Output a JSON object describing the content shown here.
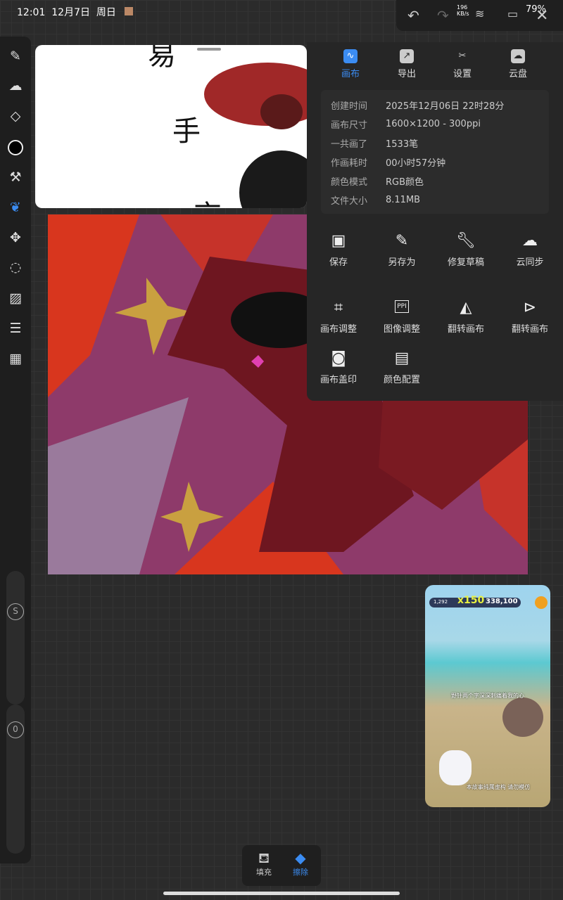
{
  "status": {
    "time": "12:01",
    "date": "12月7日",
    "weekday": "周日",
    "net_speed": "196",
    "net_unit": "KB/s",
    "battery": "79%"
  },
  "topbar": {
    "undo": "undo-icon",
    "redo": "redo-icon",
    "close": "close-icon"
  },
  "sidebar": {
    "tools": [
      "pen-icon",
      "smudge-icon",
      "eraser-icon",
      "color-icon",
      "brush-settings-icon",
      "lasso-icon",
      "move-icon",
      "selection-icon",
      "image-icon",
      "layers-adjust-icon",
      "layers-icon"
    ],
    "size_label": "S",
    "opacity_label": "0"
  },
  "reference": {
    "chars": [
      "易",
      "手",
      "京"
    ]
  },
  "panel": {
    "tabs": [
      {
        "label": "画布",
        "icon": "canvas-icon"
      },
      {
        "label": "导出",
        "icon": "export-icon"
      },
      {
        "label": "设置",
        "icon": "settings-icon"
      },
      {
        "label": "云盘",
        "icon": "cloud-disk-icon"
      }
    ],
    "info": [
      {
        "key": "创建时间",
        "value": "2025年12月06日 22时28分"
      },
      {
        "key": "画布尺寸",
        "value": "1600×1200 - 300ppi"
      },
      {
        "key": "一共画了",
        "value": "1533笔"
      },
      {
        "key": "作画耗时",
        "value": "00小时57分钟"
      },
      {
        "key": "颜色模式",
        "value": "RGB颜色"
      },
      {
        "key": "文件大小",
        "value": "8.11MB"
      }
    ],
    "actions": [
      {
        "label": "保存",
        "icon": "save-icon"
      },
      {
        "label": "另存为",
        "icon": "save-as-icon"
      },
      {
        "label": "修复草稿",
        "icon": "wrench-icon"
      },
      {
        "label": "云同步",
        "icon": "cloud-sync-icon"
      },
      {
        "label": "画布调整",
        "icon": "crop-icon"
      },
      {
        "label": "图像调整",
        "icon": "ppi-icon"
      },
      {
        "label": "翻转画布",
        "icon": "flip-horizontal-icon"
      },
      {
        "label": "翻转画布",
        "icon": "flip-vertical-icon"
      },
      {
        "label": "画布盖印",
        "icon": "camera-icon"
      },
      {
        "label": "颜色配置",
        "icon": "color-config-icon"
      }
    ]
  },
  "video": {
    "coins": "1,292",
    "multiplier": "x150",
    "score": "338,100",
    "subtitle1": "野针两个字深深刺痛着我的心",
    "subtitle2": "本故事纯属虚构 请勿模仿"
  },
  "bottombar": {
    "fill": "填充",
    "erase": "擦除"
  },
  "colors": {
    "accent": "#3b8cf2",
    "panel": "#262626"
  }
}
